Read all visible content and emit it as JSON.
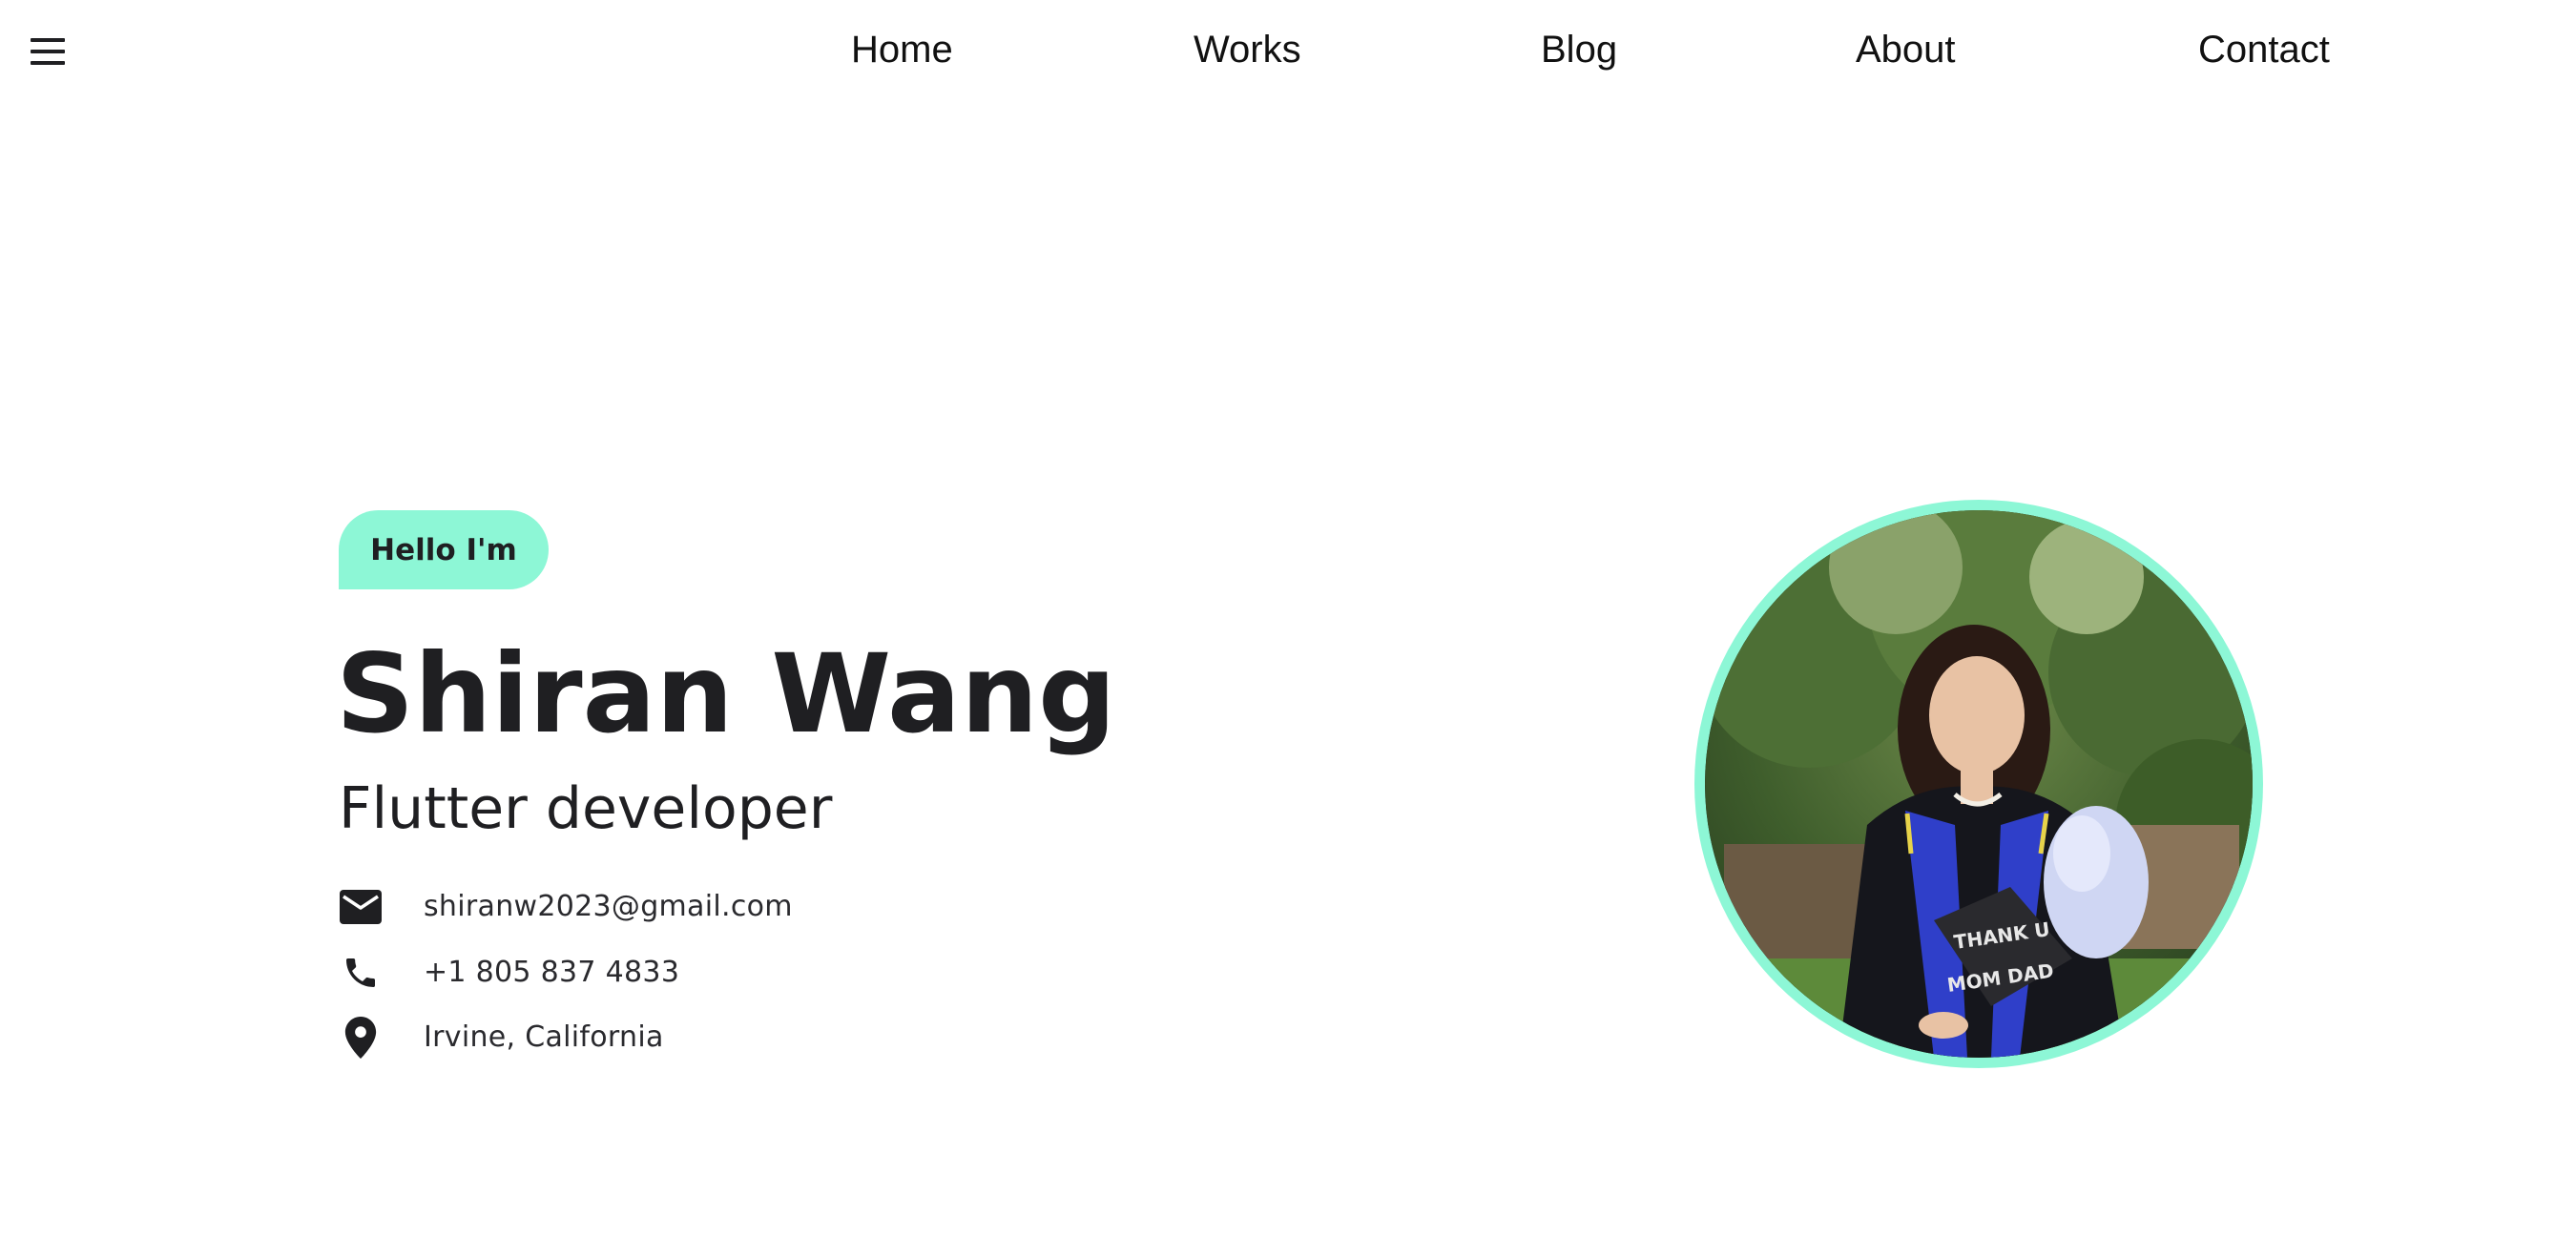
{
  "nav": {
    "menu_icon": "hamburger-menu-icon",
    "items": [
      {
        "label": "Home"
      },
      {
        "label": "Works"
      },
      {
        "label": "Blog"
      },
      {
        "label": "About"
      },
      {
        "label": "Contact"
      }
    ]
  },
  "hero": {
    "greeting": "Hello I'm",
    "name": "Shiran Wang",
    "role": "Flutter developer",
    "contacts": {
      "email": {
        "icon": "mail-icon",
        "text": "shiranw2023@gmail.com"
      },
      "phone": {
        "icon": "phone-icon",
        "text": "+1 805 837 4833"
      },
      "location": {
        "icon": "location-pin-icon",
        "text": "Irvine, California"
      }
    },
    "portrait": {
      "cap_text_line1": "THANK U",
      "cap_text_line2": "MOM DAD"
    }
  },
  "colors": {
    "accent": "#8df7d6",
    "text_dark": "#1f1f22",
    "background": "#ffffff"
  }
}
